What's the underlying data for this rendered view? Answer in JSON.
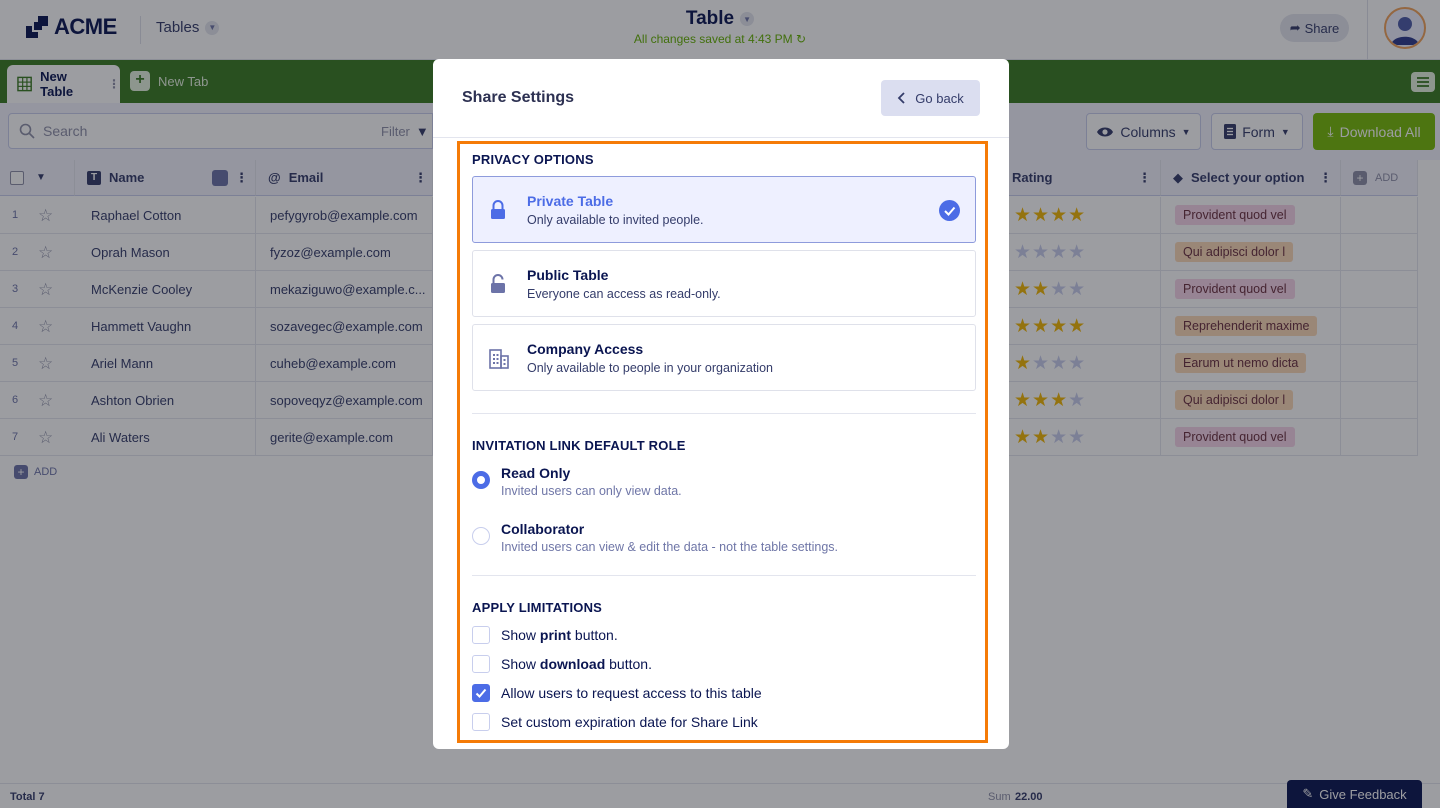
{
  "app": {
    "logo_text": "ACME",
    "tables_label": "Tables",
    "title": "Table",
    "save_status": "All changes saved at 4:43 PM",
    "share_label": "Share"
  },
  "tabs": [
    {
      "label": "New Table"
    },
    {
      "label": "New Tab"
    }
  ],
  "toolbar": {
    "search_placeholder": "Search",
    "filter_label": "Filter",
    "columns_label": "Columns",
    "form_label": "Form",
    "download_label": "Download All"
  },
  "table": {
    "columns": {
      "name": "Name",
      "email": "Email",
      "rating": "Rating",
      "select": "Select your option",
      "add": "ADD"
    },
    "rows": [
      {
        "num": "1",
        "name": "Raphael Cotton",
        "email": "pefygyrob@example.com",
        "rating": 4,
        "tag": "Provident quod vel"
      },
      {
        "num": "2",
        "name": "Oprah Mason",
        "email": "fyzoz@example.com",
        "rating": 0,
        "tag": "Qui adipisci dolor l"
      },
      {
        "num": "3",
        "name": "McKenzie Cooley",
        "email": "mekaziguwo@example.c...",
        "rating": 2,
        "tag": "Provident quod vel"
      },
      {
        "num": "4",
        "name": "Hammett Vaughn",
        "email": "sozavegec@example.com",
        "rating": 4,
        "tag": "Reprehenderit maxime"
      },
      {
        "num": "5",
        "name": "Ariel Mann",
        "email": "cuheb@example.com",
        "rating": 1,
        "tag": "Earum ut nemo dicta"
      },
      {
        "num": "6",
        "name": "Ashton Obrien",
        "email": "sopoveqyz@example.com",
        "rating": 3,
        "tag": "Qui adipisci dolor l"
      },
      {
        "num": "7",
        "name": "Ali Waters",
        "email": "gerite@example.com",
        "rating": 2,
        "tag": "Provident quod vel"
      }
    ],
    "add_row_label": "ADD"
  },
  "footer": {
    "total": "Total 7",
    "sum_label": "Sum",
    "sum_value": "22.00",
    "feedback_label": "Give Feedback"
  },
  "modal": {
    "title": "Share Settings",
    "go_back": "Go back",
    "privacy": {
      "heading": "PRIVACY OPTIONS",
      "options": [
        {
          "title": "Private Table",
          "desc": "Only available to invited people.",
          "selected": true
        },
        {
          "title": "Public Table",
          "desc": "Everyone can access as read-only.",
          "selected": false
        },
        {
          "title": "Company Access",
          "desc": "Only available to people in your organization",
          "selected": false
        }
      ]
    },
    "role": {
      "heading": "INVITATION LINK DEFAULT ROLE",
      "options": [
        {
          "title": "Read Only",
          "desc": "Invited users can only view data.",
          "selected": true
        },
        {
          "title": "Collaborator",
          "desc": "Invited users can view & edit the data - not the table settings.",
          "selected": false
        }
      ]
    },
    "limits": {
      "heading": "APPLY LIMITATIONS",
      "items": [
        {
          "pre": "Show ",
          "bold": "print",
          "post": " button.",
          "checked": false
        },
        {
          "pre": "Show ",
          "bold": "download",
          "post": " button.",
          "checked": false
        },
        {
          "pre": "Allow users to request access to this table",
          "bold": "",
          "post": "",
          "checked": true
        },
        {
          "pre": "Set custom expiration date for Share Link",
          "bold": "",
          "post": "",
          "checked": false
        }
      ]
    }
  },
  "colors": {
    "accent": "#4c6ce6",
    "highlight": "#f57b07",
    "tab_bar": "#3a7a22",
    "download_button": "#78bb07",
    "star_on": "#f2b705"
  }
}
